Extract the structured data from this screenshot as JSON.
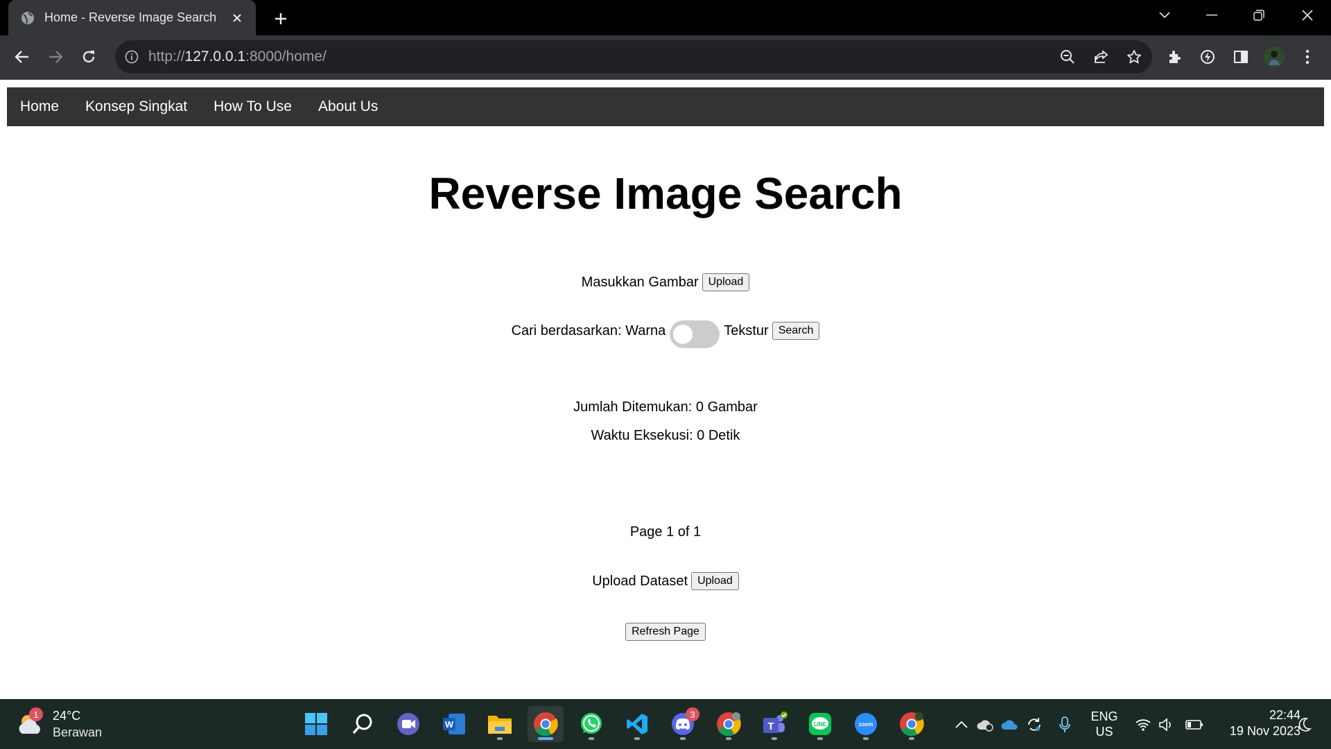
{
  "browser": {
    "tab_title": "Home - Reverse Image Search",
    "url_scheme": "http://",
    "url_host": "127.0.0.1",
    "url_rest": ":8000/home/"
  },
  "nav": {
    "items": [
      {
        "label": "Home"
      },
      {
        "label": "Konsep Singkat"
      },
      {
        "label": "How To Use"
      },
      {
        "label": "About Us"
      }
    ]
  },
  "page": {
    "heading": "Reverse Image Search",
    "input_image_label": "Masukkan Gambar",
    "upload_label": "Upload",
    "search_by_label": "Cari berdasarkan: Warna",
    "texture_label": "Tekstur",
    "search_label": "Search",
    "found_text": "Jumlah Ditemukan: 0 Gambar",
    "time_text": "Waktu Eksekusi: 0 Detik",
    "pagination_text": "Page 1 of 1",
    "dataset_label": "Upload Dataset",
    "dataset_upload_label": "Upload",
    "refresh_label": "Refresh Page"
  },
  "taskbar": {
    "weather_temp": "24°C",
    "weather_cond": "Berawan",
    "weather_badge": "1",
    "discord_badge": "3",
    "lang_line1": "ENG",
    "lang_line2": "US",
    "time": "22:44",
    "date": "19 Nov 2023",
    "accent": "#5fb2f2"
  }
}
